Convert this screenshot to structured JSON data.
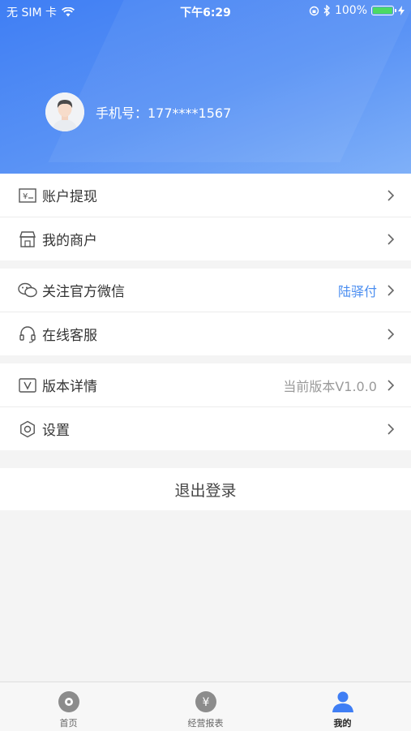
{
  "status_bar": {
    "carrier": "无 SIM 卡",
    "time": "下午6:29",
    "battery": "100%"
  },
  "profile": {
    "phone_text": "手机号：177****1567"
  },
  "menu": {
    "group1": [
      {
        "label": "账户提现",
        "icon": "cash-icon"
      },
      {
        "label": "我的商户",
        "icon": "store-icon"
      }
    ],
    "group2": [
      {
        "label": "关注官方微信",
        "value": "陆驿付",
        "icon": "wechat-icon"
      },
      {
        "label": "在线客服",
        "icon": "headset-icon"
      }
    ],
    "group3": [
      {
        "label": "版本详情",
        "value": "当前版本V1.0.0",
        "icon": "version-icon"
      },
      {
        "label": "设置",
        "icon": "gear-icon"
      }
    ]
  },
  "logout_label": "退出登录",
  "tabs": [
    {
      "label": "首页",
      "icon": "home-icon"
    },
    {
      "label": "经营报表",
      "icon": "yen-icon"
    },
    {
      "label": "我的",
      "icon": "person-icon",
      "active": true
    }
  ],
  "colors": {
    "accent": "#3f7ef4",
    "link_value": "#4a8df0",
    "muted_value": "#9a9a9a"
  }
}
